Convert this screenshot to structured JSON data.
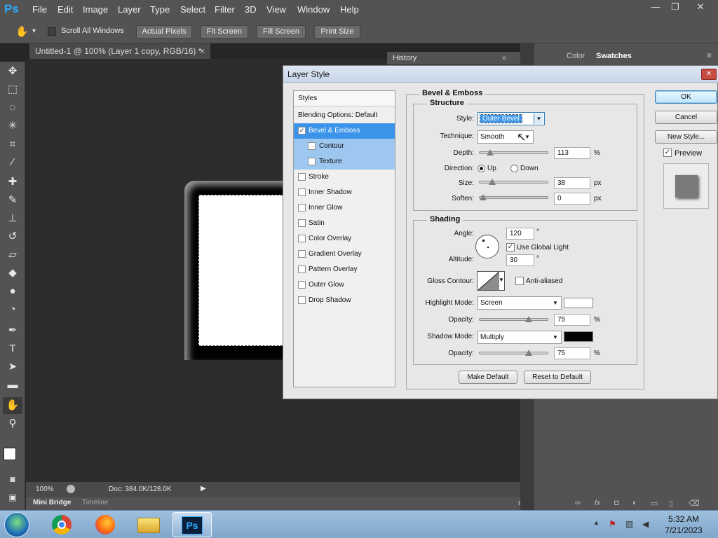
{
  "app": {
    "logo": "Ps",
    "menu": [
      "File",
      "Edit",
      "Image",
      "Layer",
      "Type",
      "Select",
      "Filter",
      "3D",
      "View",
      "Window",
      "Help"
    ],
    "window_controls": {
      "minimize": "—",
      "restore": "❐",
      "close": "✕"
    }
  },
  "options_bar": {
    "scroll_all_windows": "Scroll All Windows",
    "actual_pixels": "Actual Pixels",
    "fit_screen": "Fit Screen",
    "fill_screen": "Fill Screen",
    "print_size": "Print Size"
  },
  "document": {
    "tab_title": "Untitled-1 @ 100% (Layer 1 copy, RGB/16) *",
    "tab_close": "×"
  },
  "status": {
    "zoom": "100%",
    "doc_info": "Doc: 384.0K/128.0K"
  },
  "bottom_tabs": {
    "mini_bridge": "Mini Bridge",
    "timeline": "Timeline"
  },
  "panels": {
    "history": "History",
    "color": "Color",
    "swatches": "Swatches"
  },
  "dialog": {
    "title": "Layer Style",
    "close_glyph": "✕",
    "styles_header": "Styles",
    "styles_items": [
      {
        "label": "Blending Options: Default",
        "checkbox": false,
        "checked": false,
        "indent": false
      },
      {
        "label": "Bevel & Emboss",
        "checkbox": true,
        "checked": true,
        "indent": false
      },
      {
        "label": "Contour",
        "checkbox": true,
        "checked": false,
        "indent": true
      },
      {
        "label": "Texture",
        "checkbox": true,
        "checked": false,
        "indent": true
      },
      {
        "label": "Stroke",
        "checkbox": true,
        "checked": false,
        "indent": false
      },
      {
        "label": "Inner Shadow",
        "checkbox": true,
        "checked": false,
        "indent": false
      },
      {
        "label": "Inner Glow",
        "checkbox": true,
        "checked": false,
        "indent": false
      },
      {
        "label": "Satin",
        "checkbox": true,
        "checked": false,
        "indent": false
      },
      {
        "label": "Color Overlay",
        "checkbox": true,
        "checked": false,
        "indent": false
      },
      {
        "label": "Gradient Overlay",
        "checkbox": true,
        "checked": false,
        "indent": false
      },
      {
        "label": "Pattern Overlay",
        "checkbox": true,
        "checked": false,
        "indent": false
      },
      {
        "label": "Outer Glow",
        "checkbox": true,
        "checked": false,
        "indent": false
      },
      {
        "label": "Drop Shadow",
        "checkbox": true,
        "checked": false,
        "indent": false
      }
    ],
    "bevel_title": "Bevel & Emboss",
    "structure": {
      "title": "Structure",
      "style_label": "Style:",
      "style_value": "Outer Bevel",
      "technique_label": "Technique:",
      "technique_value": "Smooth",
      "depth_label": "Depth:",
      "depth_value": "113",
      "depth_level": 0.113,
      "percent": "%",
      "direction_label": "Direction:",
      "direction_up": "Up",
      "direction_down": "Down",
      "size_label": "Size:",
      "size_value": "38",
      "size_level": 0.152,
      "soften_label": "Soften:",
      "soften_value": "0",
      "soften_level": 0,
      "px": "px"
    },
    "shading": {
      "title": "Shading",
      "angle_label": "Angle:",
      "angle_value": "120",
      "degree": "°",
      "use_global_light": "Use Global Light",
      "altitude_label": "Altitude:",
      "altitude_value": "30",
      "gloss_label": "Gloss Contour:",
      "anti_aliased": "Anti-aliased",
      "highlight_mode_label": "Highlight Mode:",
      "highlight_mode_value": "Screen",
      "highlight_color": "#ffffff",
      "opacity_label": "Opacity:",
      "highlight_opacity": "75",
      "highlight_level": 0.75,
      "shadow_mode_label": "Shadow Mode:",
      "shadow_mode_value": "Multiply",
      "shadow_color": "#000000",
      "shadow_opacity": "75",
      "shadow_level": 0.75
    },
    "make_default": "Make Default",
    "reset_to_default": "Reset to Default",
    "ok": "OK",
    "cancel": "Cancel",
    "new_style": "New Style...",
    "preview_label": "Preview"
  },
  "taskbar": {
    "time": "5:32 AM",
    "date": "7/21/2023",
    "ps_label": "Ps"
  },
  "icons": {
    "hand": "✋",
    "arrow_down": "▾",
    "dropdown": "▼",
    "check": "✓",
    "play": "▶",
    "collapse": "»",
    "menu": "≡",
    "cursor": "↖"
  }
}
